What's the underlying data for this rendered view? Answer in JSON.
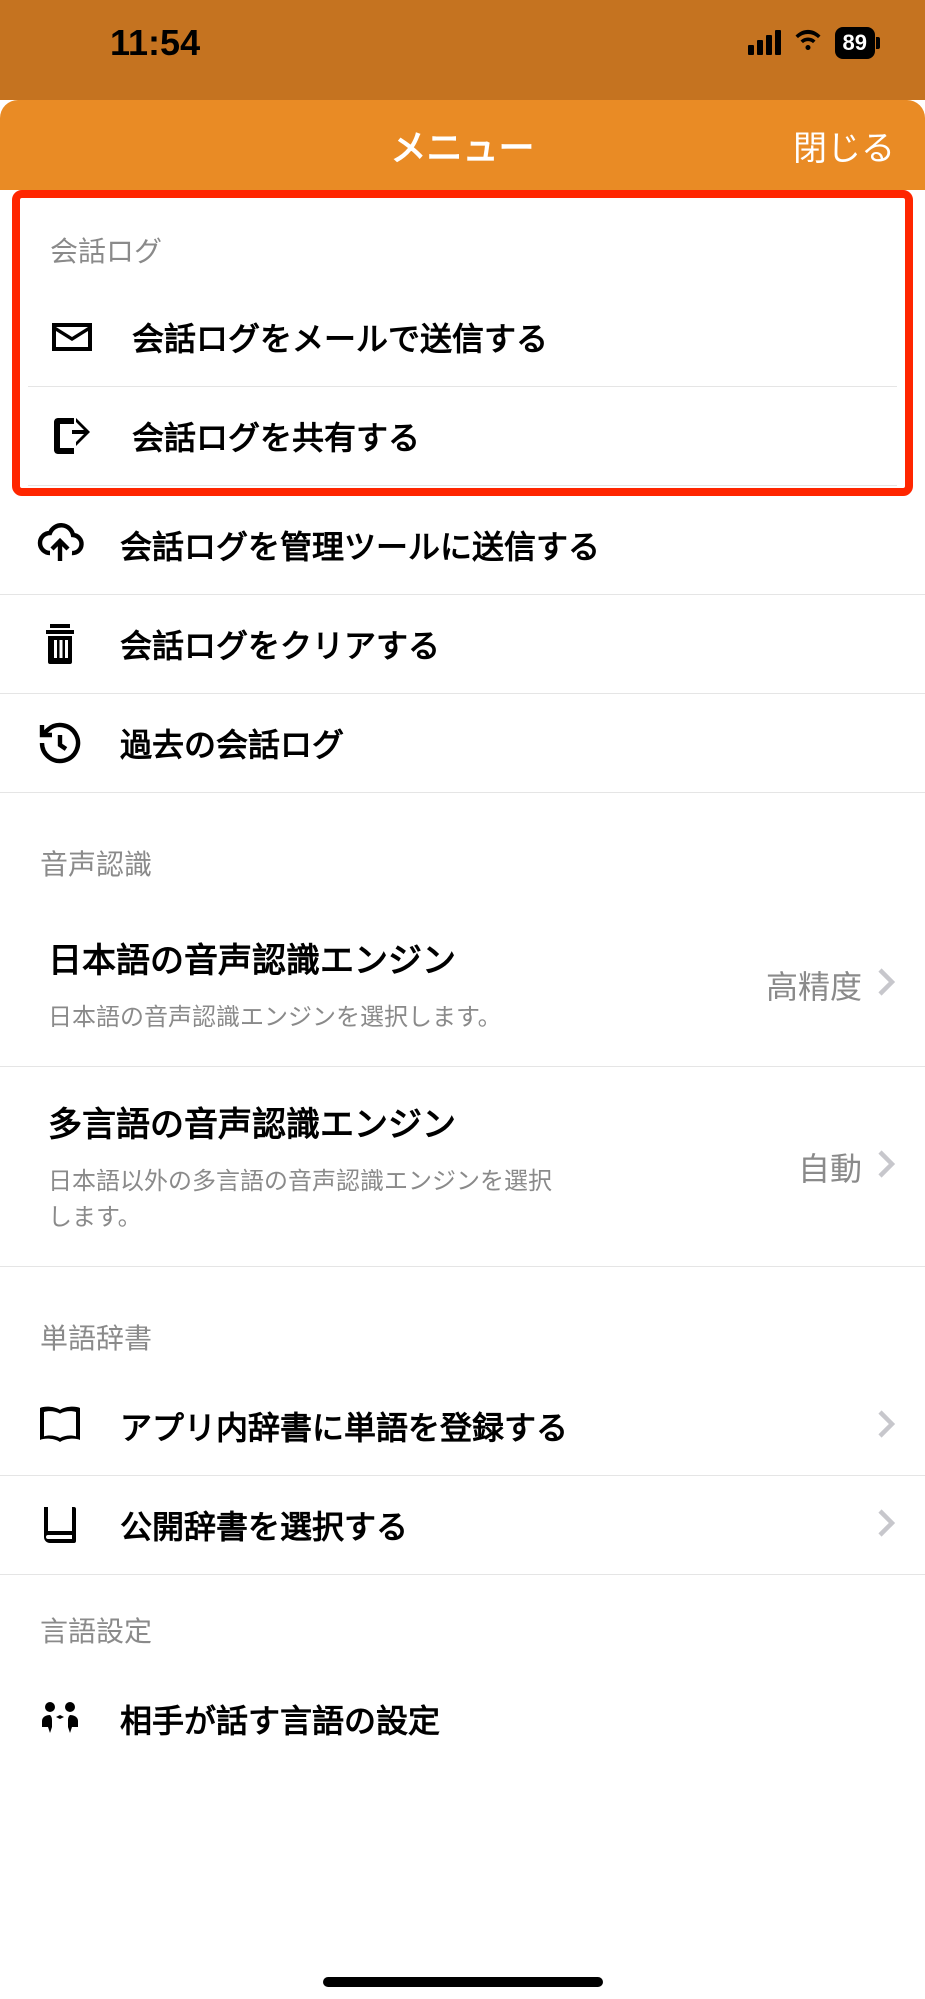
{
  "status": {
    "time": "11:54",
    "battery": "89"
  },
  "nav": {
    "title": "メニュー",
    "close": "閉じる"
  },
  "sections": {
    "log": {
      "header": "会話ログ",
      "items": {
        "mail": "会話ログをメールで送信する",
        "share": "会話ログを共有する",
        "upload": "会話ログを管理ツールに送信する",
        "clear": "会話ログをクリアする",
        "history": "過去の会話ログ"
      }
    },
    "voice": {
      "header": "音声認識",
      "jp": {
        "title": "日本語の音声認識エンジン",
        "sub": "日本語の音声認識エンジンを選択します。",
        "value": "高精度"
      },
      "multi": {
        "title": "多言語の音声認識エンジン",
        "sub": "日本語以外の多言語の音声認識エンジンを選択します。",
        "value": "自動"
      }
    },
    "dict": {
      "header": "単語辞書",
      "register": "アプリ内辞書に単語を登録する",
      "select": "公開辞書を選択する"
    },
    "lang": {
      "header": "言語設定",
      "partner": "相手が話す言語の設定"
    }
  }
}
